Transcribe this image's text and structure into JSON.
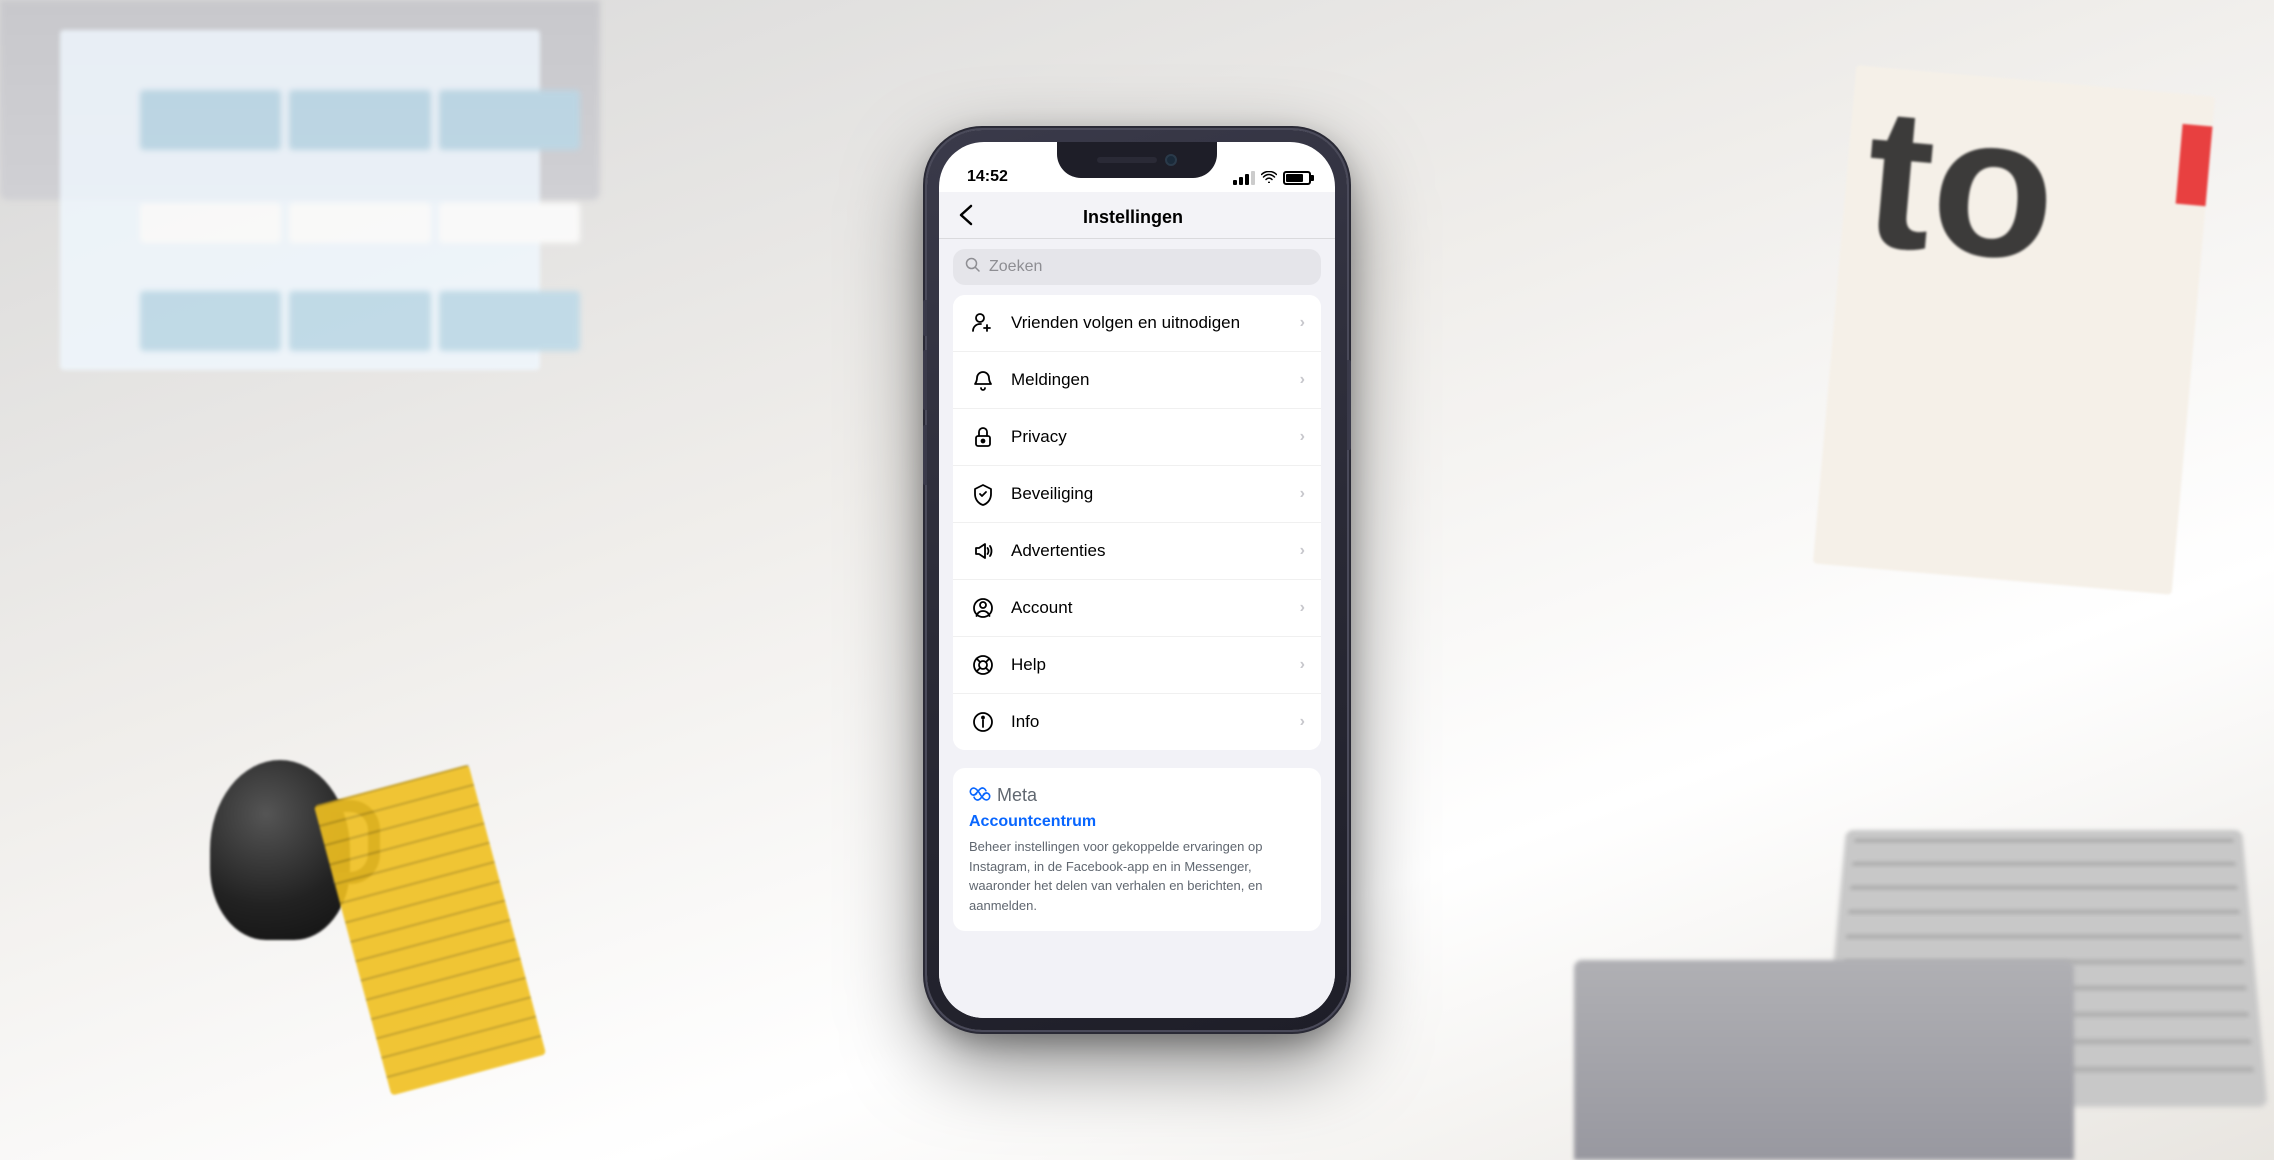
{
  "background": {
    "label": "desk background"
  },
  "phone": {
    "status_bar": {
      "time": "14:52"
    },
    "nav": {
      "back_label": "‹",
      "title": "Instellingen"
    },
    "search": {
      "placeholder": "Zoeken"
    },
    "menu_items": [
      {
        "id": "follow-friends",
        "label": "Vrienden volgen en uitnodigen",
        "icon": "add-person-icon"
      },
      {
        "id": "notifications",
        "label": "Meldingen",
        "icon": "bell-icon"
      },
      {
        "id": "privacy",
        "label": "Privacy",
        "icon": "lock-icon"
      },
      {
        "id": "security",
        "label": "Beveiliging",
        "icon": "shield-icon"
      },
      {
        "id": "ads",
        "label": "Advertenties",
        "icon": "megaphone-icon"
      },
      {
        "id": "account",
        "label": "Account",
        "icon": "account-icon"
      },
      {
        "id": "help",
        "label": "Help",
        "icon": "help-circle-icon"
      },
      {
        "id": "info",
        "label": "Info",
        "icon": "info-circle-icon"
      }
    ],
    "meta_section": {
      "logo_symbol": "∞",
      "logo_text": "Meta",
      "link_label": "Accountcentrum",
      "description": "Beheer instellingen voor gekoppelde ervaringen op Instagram, in de Facebook-app en in Messenger, waaronder het delen van verhalen en berichten, en aanmelden."
    }
  }
}
